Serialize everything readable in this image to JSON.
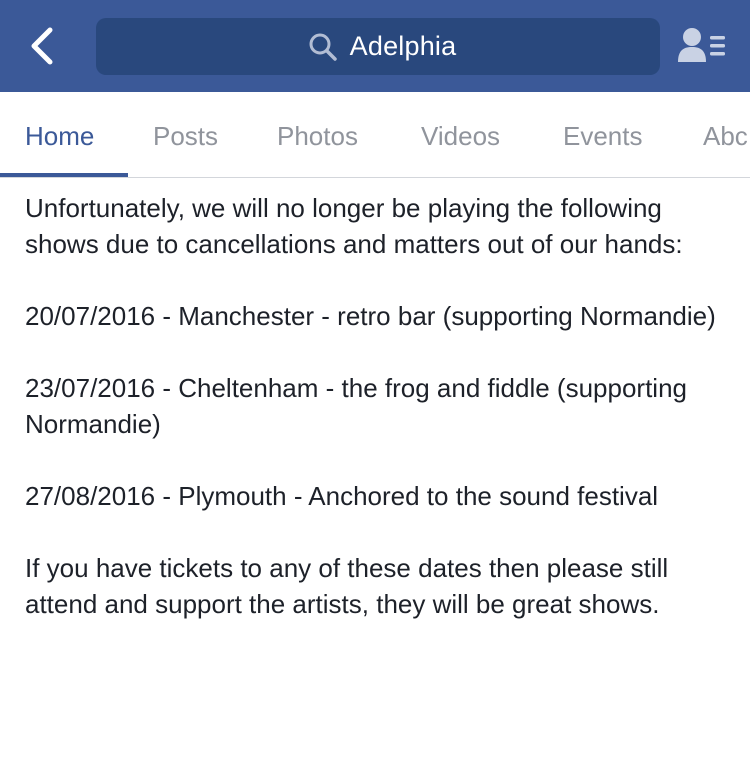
{
  "header": {
    "search_text": "Adelphia"
  },
  "tabs": [
    {
      "label": "Home"
    },
    {
      "label": "Posts"
    },
    {
      "label": "Photos"
    },
    {
      "label": "Videos"
    },
    {
      "label": "Events"
    },
    {
      "label": "Abc"
    }
  ],
  "post": {
    "paragraphs": [
      "Unfortunately, we will no longer be playing the following shows due to cancellations and matters out of our hands:",
      "20/07/2016 - Manchester - retro bar (supporting Normandie)",
      "23/07/2016 - Cheltenham - the frog and fiddle (supporting Normandie)",
      "27/08/2016 - Plymouth - Anchored to the sound festival",
      "If you have tickets to any of these dates then please still attend and support the artists, they will be great shows."
    ]
  },
  "colors": {
    "header_bg": "#3b5998",
    "search_bg": "#29487d",
    "tab_active": "#3b5998",
    "tab_inactive": "#90949c"
  },
  "icons": {
    "back": "back-chevron-icon",
    "search": "search-icon",
    "profile": "profile-list-icon"
  }
}
